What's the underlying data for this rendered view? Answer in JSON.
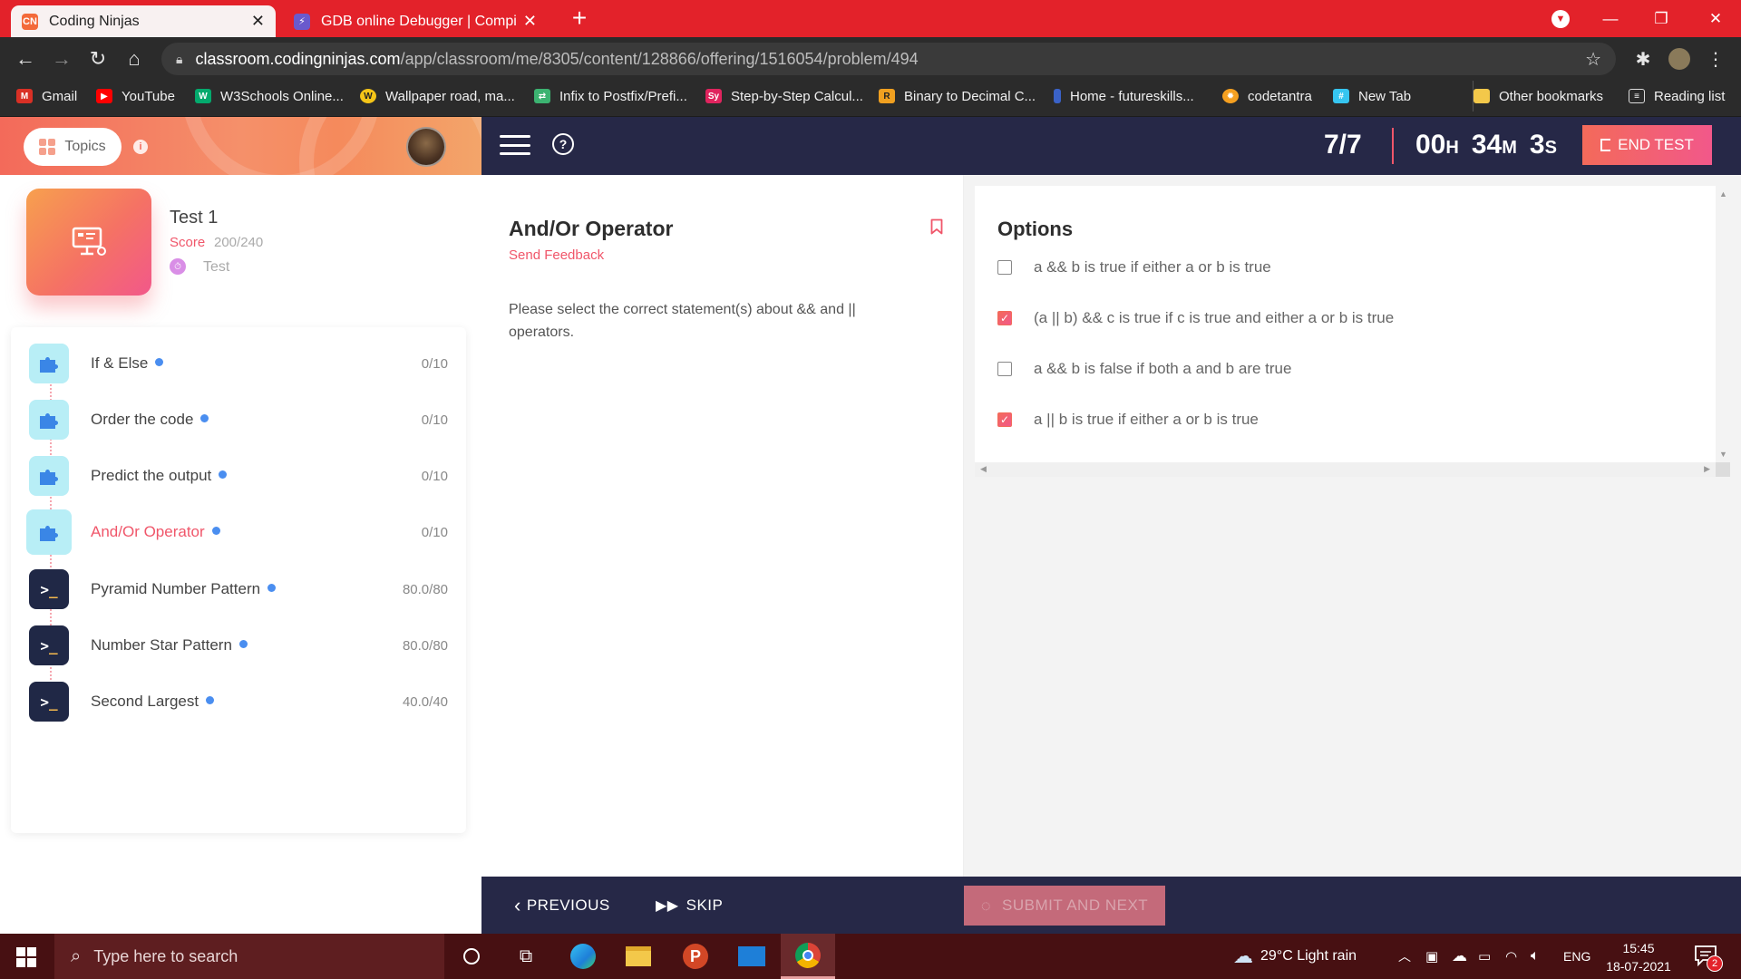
{
  "browser": {
    "tabs": [
      {
        "title": "Coding Ninjas",
        "favicon": "coding-ninjas-icon"
      },
      {
        "title": "GDB online Debugger | Compiler",
        "favicon": "gdb-icon"
      }
    ],
    "url_host": "classroom.codingninjas.com",
    "url_path": "/app/classroom/me/8305/content/128866/offering/1516054/problem/494",
    "bookmarks": [
      {
        "label": "Gmail",
        "icon": "gmail-icon",
        "color": "#d93025"
      },
      {
        "label": "YouTube",
        "icon": "youtube-icon",
        "color": "#ff0000"
      },
      {
        "label": "W3Schools Online...",
        "icon": "w3schools-icon",
        "color": "#04aa6d"
      },
      {
        "label": "Wallpaper road, ma...",
        "icon": "wallpaper-icon",
        "color": "#f5c518"
      },
      {
        "label": "Infix to Postfix/Prefi...",
        "icon": "infix-icon",
        "color": "#3cb371"
      },
      {
        "label": "Step-by-Step Calcul...",
        "icon": "symbolab-icon",
        "color": "#e0245e"
      },
      {
        "label": "Binary to Decimal C...",
        "icon": "rapidtables-icon",
        "color": "#f0a020"
      },
      {
        "label": "Home - futureskills...",
        "icon": "futureskills-icon",
        "color": "#3a62c8"
      },
      {
        "label": "codetantra",
        "icon": "codetantra-icon",
        "color": "#f5a020"
      },
      {
        "label": "New Tab",
        "icon": "slack-icon",
        "color": "#36c5f0"
      }
    ],
    "other_bookmarks": "Other bookmarks",
    "reading_list": "Reading list"
  },
  "sidebar": {
    "topics_label": "Topics",
    "test_title": "Test 1",
    "score_label": "Score",
    "score_value": "200/240",
    "test_type": "Test",
    "problems": [
      {
        "name": "If & Else",
        "score": "0/10",
        "type": "puzzle",
        "active": false
      },
      {
        "name": "Order the code",
        "score": "0/10",
        "type": "puzzle",
        "active": false
      },
      {
        "name": "Predict the output",
        "score": "0/10",
        "type": "puzzle",
        "active": false
      },
      {
        "name": "And/Or Operator",
        "score": "0/10",
        "type": "puzzle",
        "active": true
      },
      {
        "name": "Pyramid Number Pattern",
        "score": "80.0/80",
        "type": "code",
        "active": false
      },
      {
        "name": "Number Star Pattern",
        "score": "80.0/80",
        "type": "code",
        "active": false
      },
      {
        "name": "Second Largest",
        "score": "40.0/40",
        "type": "code",
        "active": false
      }
    ]
  },
  "header": {
    "progress": "7/7",
    "timer": {
      "hours": "00",
      "h_unit": "H",
      "minutes": "34",
      "m_unit": "M",
      "seconds": "3",
      "s_unit": "S"
    },
    "end_test_label": "END TEST"
  },
  "question": {
    "title": "And/Or Operator",
    "feedback_label": "Send Feedback",
    "text": "Please select the correct statement(s) about && and || operators."
  },
  "options": {
    "title": "Options",
    "items": [
      {
        "text": "a && b is true if either a or b is true",
        "checked": false
      },
      {
        "text": "(a || b) && c is true if c is true and either a or b is true",
        "checked": true
      },
      {
        "text": "a && b is false if both a and b are true",
        "checked": false
      },
      {
        "text": "a || b is true if either a or b is true",
        "checked": true
      }
    ]
  },
  "footer": {
    "previous_label": "PREVIOUS",
    "skip_label": "SKIP",
    "submit_label": "SUBMIT AND NEXT"
  },
  "taskbar": {
    "search_placeholder": "Type here to search",
    "weather": "29°C  Light rain",
    "language": "ENG",
    "time": "15:45",
    "date": "18-07-2021",
    "notification_count": "2"
  },
  "colors": {
    "tabbar": "#e3222a",
    "accent": "#f0566a",
    "header_dark": "#262847",
    "dot_blue": "#4a8ef0"
  }
}
